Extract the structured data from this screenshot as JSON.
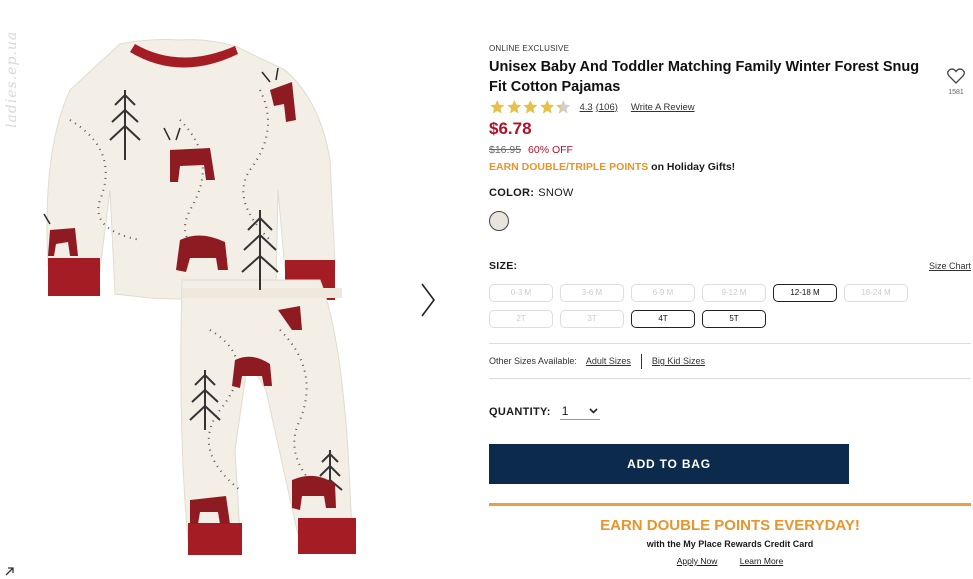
{
  "watermark": "ladies.ep.ua",
  "product": {
    "eyebrow": "ONLINE EXCLUSIVE",
    "title": "Unisex Baby And Toddler Matching Family Winter Forest Snug Fit Cotton Pajamas",
    "wishlist_count": "1581",
    "rating": 4.3,
    "rating_text": "4.3",
    "review_count": "(106)",
    "write_review": "Write A Review",
    "price": "$6.78",
    "was_price": "$16.95",
    "discount": "60% OFF",
    "promo_highlight": "EARN DOUBLE/TRIPLE POINTS",
    "promo_rest": " on Holiday Gifts!",
    "color_label": "COLOR:",
    "color_value": "SNOW",
    "size_label": "SIZE:",
    "size_chart": "Size Chart",
    "sizes": [
      {
        "label": "0-3 M",
        "available": false
      },
      {
        "label": "3-6 M",
        "available": false
      },
      {
        "label": "6-9 M",
        "available": false
      },
      {
        "label": "9-12 M",
        "available": false
      },
      {
        "label": "12-18 M",
        "available": true
      },
      {
        "label": "18-24 M",
        "available": false
      },
      {
        "label": "2T",
        "available": false
      },
      {
        "label": "3T",
        "available": false
      },
      {
        "label": "4T",
        "available": true
      },
      {
        "label": "5T",
        "available": true
      }
    ],
    "other_sizes_label": "Other Sizes Available:",
    "adult_sizes": "Adult Sizes",
    "big_kid_sizes": "Big Kid Sizes",
    "quantity_label": "QUANTITY:",
    "quantity_value": "1",
    "add_to_bag": "ADD TO BAG"
  },
  "rewards": {
    "title": "EARN DOUBLE POINTS EVERYDAY!",
    "subtitle": "with the My Place Rewards Credit Card",
    "apply": "Apply Now",
    "learn": "Learn More"
  },
  "colors": {
    "price_red": "#b3102a",
    "accent_orange": "#e8952e",
    "button_navy": "#0b2a4c",
    "star_gold": "#e5c04a",
    "pajama_red": "#a51d24"
  }
}
